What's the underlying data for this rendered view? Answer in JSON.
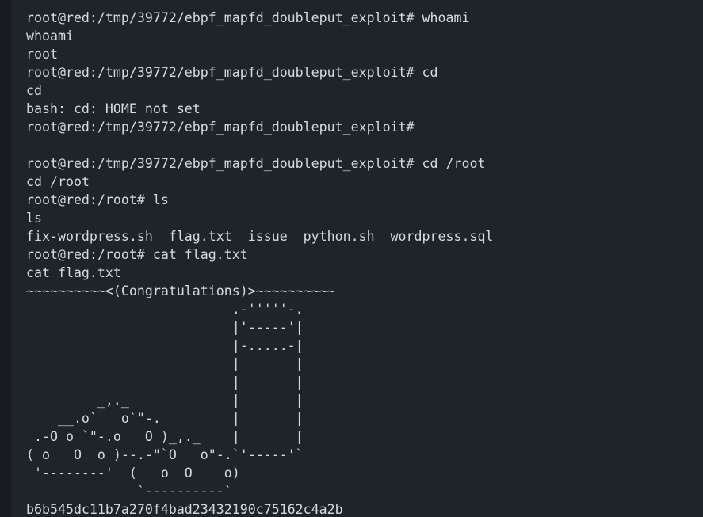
{
  "terminal": {
    "prompt_tmp": "root@red:/tmp/39772/ebpf_mapfd_doubleput_exploit#",
    "prompt_root": "root@red:/root#",
    "lines": [
      {
        "kind": "cmd",
        "prompt": "root@red:/tmp/39772/ebpf_mapfd_doubleput_exploit#",
        "command": " whoami"
      },
      {
        "kind": "out",
        "text": "whoami"
      },
      {
        "kind": "out",
        "text": "root"
      },
      {
        "kind": "cmd",
        "prompt": "root@red:/tmp/39772/ebpf_mapfd_doubleput_exploit#",
        "command": " cd"
      },
      {
        "kind": "out",
        "text": "cd"
      },
      {
        "kind": "out",
        "text": "bash: cd: HOME not set"
      },
      {
        "kind": "cmd",
        "prompt": "root@red:/tmp/39772/ebpf_mapfd_doubleput_exploit#",
        "command": ""
      },
      {
        "kind": "out",
        "text": ""
      },
      {
        "kind": "cmd",
        "prompt": "root@red:/tmp/39772/ebpf_mapfd_doubleput_exploit#",
        "command": " cd /root"
      },
      {
        "kind": "out",
        "text": "cd /root"
      },
      {
        "kind": "cmd",
        "prompt": "root@red:/root#",
        "command": " ls"
      },
      {
        "kind": "out",
        "text": "ls"
      },
      {
        "kind": "out",
        "text": "fix-wordpress.sh  flag.txt  issue  python.sh  wordpress.sql"
      },
      {
        "kind": "cmd",
        "prompt": "root@red:/root#",
        "command": " cat flag.txt"
      },
      {
        "kind": "out",
        "text": "cat flag.txt"
      },
      {
        "kind": "out",
        "text": "~~~~~~~~~~<(Congratulations)>~~~~~~~~~~"
      },
      {
        "kind": "out",
        "text": "                          .-'''''-."
      },
      {
        "kind": "out",
        "text": "                          |'-----'|"
      },
      {
        "kind": "out",
        "text": "                          |-.....-|"
      },
      {
        "kind": "out",
        "text": "                          |       |"
      },
      {
        "kind": "out",
        "text": "                          |       |"
      },
      {
        "kind": "out",
        "text": "         _,._             |       |"
      },
      {
        "kind": "out",
        "text": "    __.o`   o`\"-.         |       |"
      },
      {
        "kind": "out",
        "text": " .-O o `\"-.o   O )_,._    |       |"
      },
      {
        "kind": "out",
        "text": "( o   O  o )--.-\"`O   o\"-.`'-----'`"
      },
      {
        "kind": "out",
        "text": " '--------'  (   o  O    o)"
      },
      {
        "kind": "out",
        "text": "              `----------`"
      },
      {
        "kind": "out",
        "text": "b6b545dc11b7a270f4bad23432190c75162c4a2b"
      }
    ]
  }
}
